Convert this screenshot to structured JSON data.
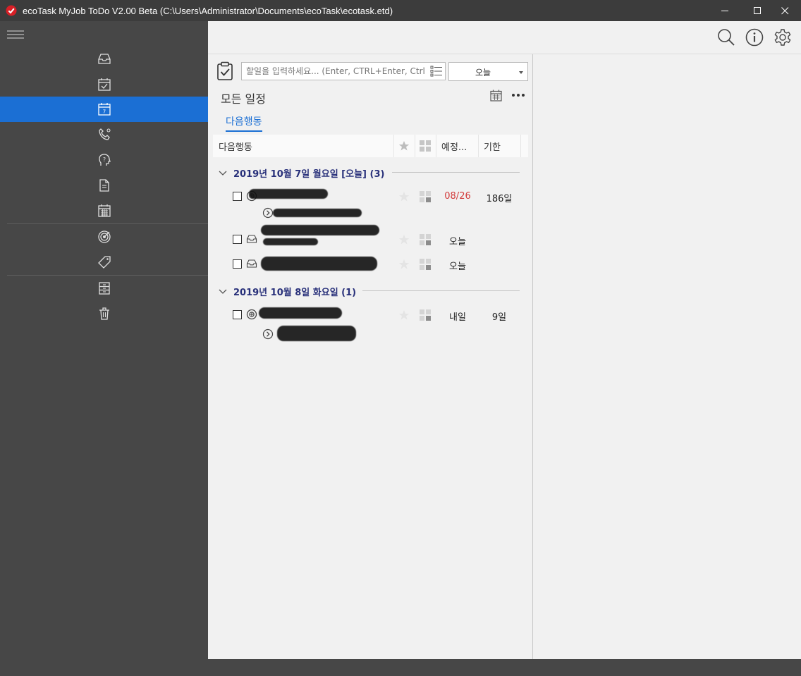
{
  "window": {
    "title": "ecoTask MyJob ToDo V2.00 Beta (C:\\Users\\Administrator\\Documents\\ecoTask\\ecotask.etd)"
  },
  "colors": {
    "accent": "#1b6fd4",
    "sidebar": "#474747",
    "overdue": "#d23a3a",
    "group_header": "#28307a"
  },
  "sidebar": {
    "items": [
      {
        "icon": "inbox-icon"
      },
      {
        "icon": "calendar-check-icon"
      },
      {
        "icon": "calendar-7-icon",
        "active": true,
        "badge": "7"
      },
      {
        "icon": "phone-icon"
      },
      {
        "icon": "question-head-icon"
      },
      {
        "icon": "document-icon"
      },
      {
        "icon": "calendar-grid-icon"
      },
      {
        "icon": "target-icon"
      },
      {
        "icon": "tag-icon"
      },
      {
        "icon": "archive-icon"
      },
      {
        "icon": "trash-icon"
      }
    ]
  },
  "toolbar": {
    "icons": [
      "search-icon",
      "info-icon",
      "settings-icon"
    ]
  },
  "input": {
    "placeholder": "할일을 입력하세요... (Enter, CTRL+Enter, Ctrl"
  },
  "date_select": {
    "value": "오늘"
  },
  "list": {
    "title": "모든 일정",
    "tab": "다음행동",
    "columns": {
      "name": "다음행동",
      "scheduled": "예정...",
      "due": "기한"
    }
  },
  "groups": [
    {
      "label": "2019년 10월 7일 월요일 [오늘] (3)",
      "tasks": [
        {
          "icon": "target-add-icon",
          "scheduled": "08/26",
          "scheduled_overdue": true,
          "due": "186일",
          "has_sub": true
        },
        {
          "icon": "inbox-icon",
          "scheduled": "오늘",
          "due": ""
        },
        {
          "icon": "inbox-icon",
          "scheduled": "오늘",
          "due": ""
        }
      ]
    },
    {
      "label": "2019년 10월 8일 화요일 (1)",
      "tasks": [
        {
          "icon": "target-add-icon",
          "scheduled": "내일",
          "due": "9일",
          "has_sub": true
        }
      ]
    }
  ]
}
